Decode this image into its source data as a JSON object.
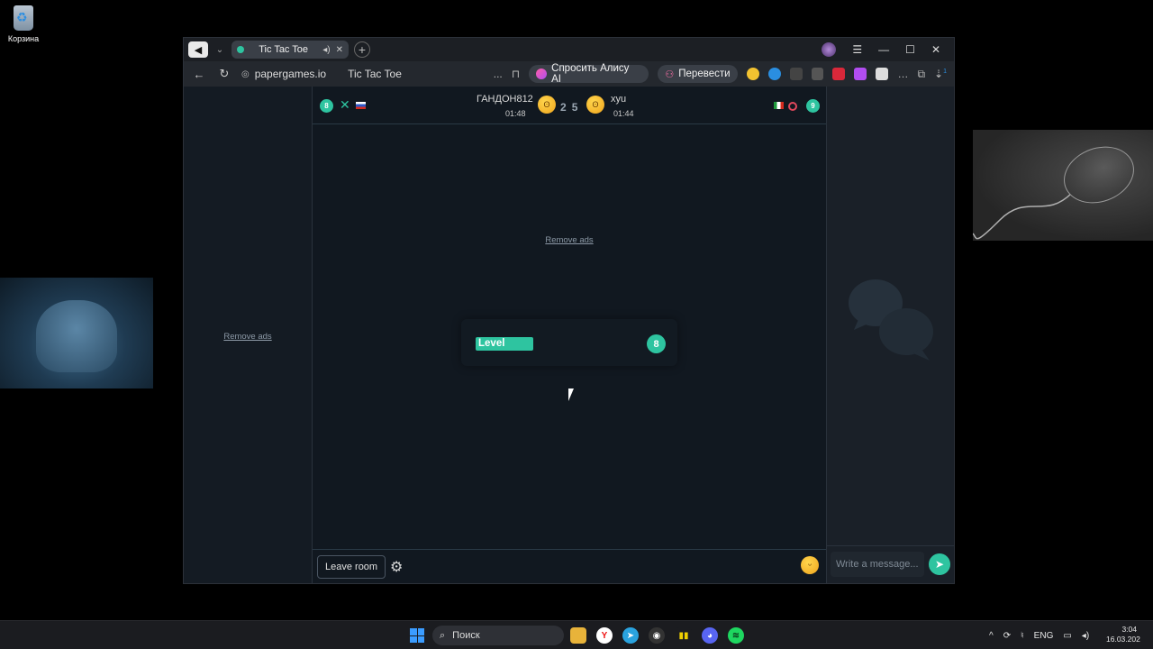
{
  "desktop": {
    "recycle_bin_label": "Корзина"
  },
  "browser": {
    "tab_title": "Tic Tac Toe",
    "url": "papergames.io",
    "page_title": "Tic Tac Toe",
    "ask_alice_label": "Спросить Алису AI",
    "translate_label": "Перевести",
    "more_label": "...",
    "downloads_badge": "1"
  },
  "game": {
    "player1": {
      "name": "ГАНДОН812",
      "time": "01:48",
      "level": "8",
      "mark": "X"
    },
    "player2": {
      "name": "xyu",
      "time": "01:44",
      "level": "9",
      "mark": "O"
    },
    "score": [
      "2",
      "5"
    ],
    "remove_ads": "Remove ads",
    "level_label": "Level",
    "level_value": "8",
    "level_progress": 0.3,
    "leave_room_label": "Leave room"
  },
  "sidebar": {
    "remove_ads": "Remove ads"
  },
  "chat": {
    "placeholder": "Write a message..."
  },
  "taskbar": {
    "search_label": "Поиск",
    "lang": "ENG",
    "time": "3:04",
    "date": "16.03.202"
  },
  "colors": {
    "accent": "#2ec4a0",
    "o_mark": "#e0485c"
  }
}
